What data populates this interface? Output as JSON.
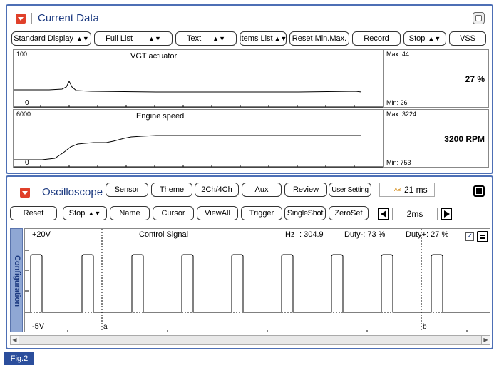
{
  "current_data": {
    "title": "Current Data",
    "buttons": {
      "standard_display": "Standard Display",
      "full_list": "Full List",
      "text": "Text",
      "items_list": "Items List",
      "reset_minmax": "Reset Min.Max.",
      "record": "Record",
      "stop": "Stop",
      "vss": "VSS"
    },
    "graphs": [
      {
        "top_label": "100",
        "bottom_label": "0",
        "name": "VGT actuator",
        "max": "Max: 44",
        "min": "Min: 26",
        "value": "27 %"
      },
      {
        "top_label": "6000",
        "bottom_label": "0",
        "name": "Engine speed",
        "max": "Max: 3224",
        "min": "Min: 753",
        "value": "3200 RPM"
      }
    ]
  },
  "oscilloscope": {
    "title": "Oscilloscope",
    "buttons": {
      "sensor": "Sensor",
      "theme": "Theme",
      "ch": "2Ch/4Ch",
      "aux": "Aux",
      "review": "Review",
      "user_setting": "User Setting",
      "reset": "Reset",
      "stop": "Stop",
      "name": "Name",
      "cursor": "Cursor",
      "viewall": "ViewAll",
      "trigger": "Trigger",
      "singleshot": "SingleShot",
      "zeroset": "ZeroSet"
    },
    "time_badge": "21 ms",
    "time_badge_icon": "AB",
    "timescale": "2ms",
    "side_tab": "Configuration",
    "plot": {
      "y_top": "+20V",
      "y_bottom": "-5V",
      "signal_name": "Control Signal",
      "hz_label": "Hz",
      "hz_value": ": 304.9",
      "duty_minus": "Duty-: 73 %",
      "duty_plus": "Duty+: 27 %",
      "cursor_a": "a",
      "cursor_b": "b"
    }
  },
  "figure_label": "Fig.2",
  "colors": {
    "panel_border": "#4d6fb5",
    "accent_red": "#e0402a",
    "title_blue": "#1c3a80",
    "fig_bg": "#2b4e9c"
  }
}
